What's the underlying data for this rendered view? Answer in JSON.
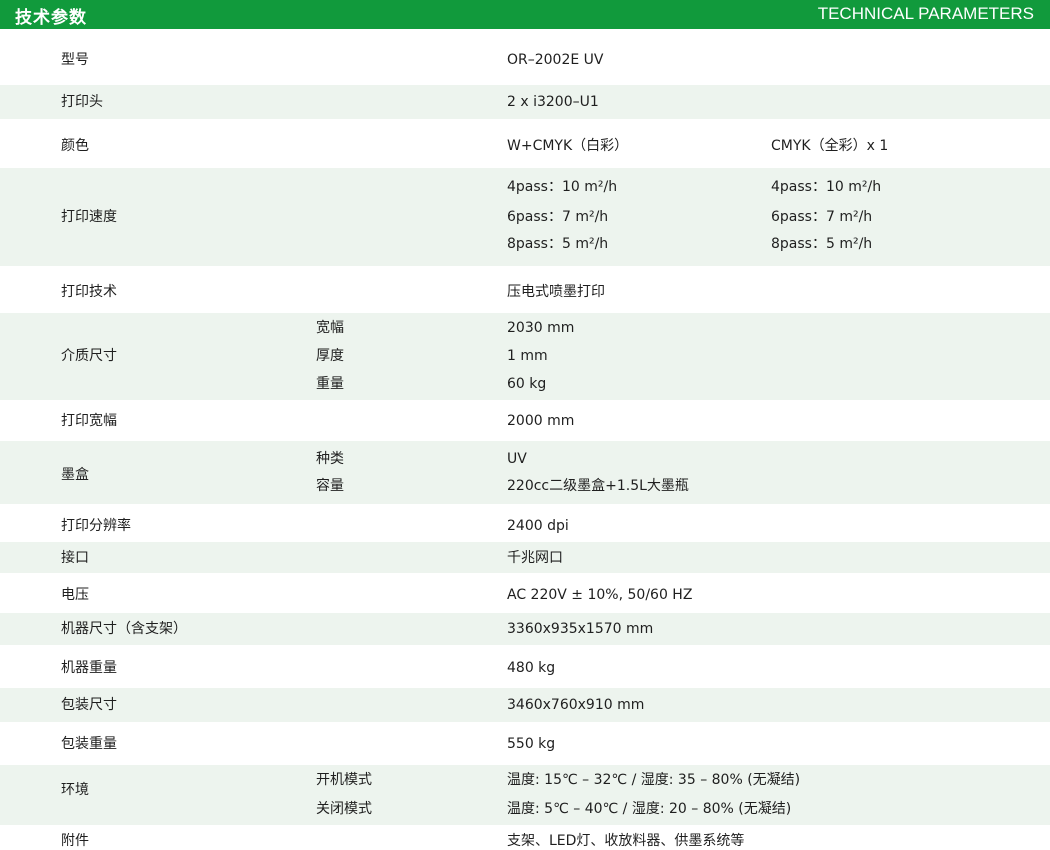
{
  "header": {
    "title_cn": "技术参数",
    "title_en": "TECHNICAL PARAMETERS",
    "bg_color": "#119a3c"
  },
  "specs": [
    {
      "label": "型号",
      "value": "OR–2002E UV"
    },
    {
      "label": "打印头",
      "value": "2 x i3200–U1"
    },
    {
      "label": "颜色",
      "value": "W+CMYK（白彩）",
      "value2": "CMYK（全彩）x 1"
    },
    {
      "label": "打印速度",
      "lines": [
        "4pass：10 m²/h",
        "6pass：7 m²/h",
        "8pass：5 m²/h"
      ],
      "lines2": [
        "4pass：10 m²/h",
        "6pass：7 m²/h",
        "8pass：5 m²/h"
      ]
    },
    {
      "label": "打印技术",
      "value": "压电式喷墨打印"
    },
    {
      "label": "介质尺寸",
      "subs": [
        {
          "name": "宽幅",
          "value": "2030 mm"
        },
        {
          "name": "厚度",
          "value": "1 mm"
        },
        {
          "name": "重量",
          "value": "60 kg"
        }
      ]
    },
    {
      "label": "打印宽幅",
      "value": "2000 mm"
    },
    {
      "label": "墨盒",
      "subs": [
        {
          "name": "种类",
          "value": "UV"
        },
        {
          "name": "容量",
          "value": "220cc二级墨盒+1.5L大墨瓶"
        }
      ]
    },
    {
      "label": "打印分辨率",
      "value": "2400 dpi"
    },
    {
      "label": "接口",
      "value": "千兆网口"
    },
    {
      "label": "电压",
      "value": "AC 220V ± 10%, 50/60 HZ"
    },
    {
      "label": "机器尺寸（含支架）",
      "value": "3360x935x1570 mm"
    },
    {
      "label": "机器重量",
      "value": "480 kg"
    },
    {
      "label": "包装尺寸",
      "value": "3460x760x910 mm"
    },
    {
      "label": "包装重量",
      "value": "550 kg"
    },
    {
      "label": "环境",
      "subs": [
        {
          "name": "开机模式",
          "value": "温度: 15℃ – 32℃ / 湿度: 35 – 80% (无凝结)"
        },
        {
          "name": "关闭模式",
          "value": "温度: 5℃ – 40℃ / 湿度: 20 – 80% (无凝结)"
        }
      ]
    },
    {
      "label": "附件",
      "value": "支架、LED灯、收放料器、供墨系统等"
    }
  ]
}
